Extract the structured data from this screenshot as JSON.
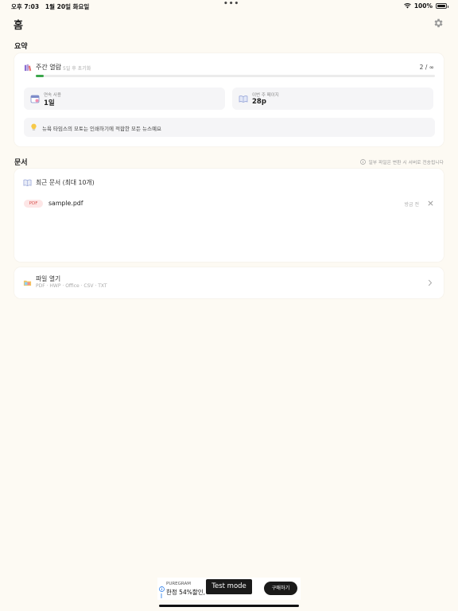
{
  "status_bar": {
    "time": "오후 7:03",
    "date": "1월 20일 화요일",
    "dots": "•••",
    "battery": "100%",
    "wifi_icon": "wifi-icon",
    "battery_icon": "battery-icon"
  },
  "header": {
    "title": "홈",
    "settings_icon": "gear-icon"
  },
  "summary": {
    "section_label": "요약",
    "weekly_reading": {
      "title": "주간 열람",
      "reset_note": "5일 후 초기화",
      "count": "2 / ∞",
      "progress": 0.02,
      "progress_color": "#3aa64a"
    },
    "stats": [
      {
        "label": "연속 사용",
        "value": "1일"
      },
      {
        "label": "이번 주 페이지",
        "value": "28p"
      }
    ],
    "tip": "뉴욕 타임스의 모토는 인쇄하기에 적합한 모든 뉴스예요"
  },
  "documents": {
    "section_label": "문서",
    "note": "일부 파일은 변환 시 서버로 전송됩니다",
    "recent_title": "최근 문서 (최대 10개)",
    "files": [
      {
        "badge": "PDF",
        "name": "sample.pdf",
        "time": "방금 전"
      }
    ]
  },
  "open_file": {
    "title": "파일 열기",
    "formats": "PDF · HWP · Office · CSV · TXT"
  },
  "ad": {
    "brand": "PUREGRAM",
    "text": "한정 54%할인, 단",
    "test_mode": "Test mode",
    "buy": "구매하기"
  }
}
